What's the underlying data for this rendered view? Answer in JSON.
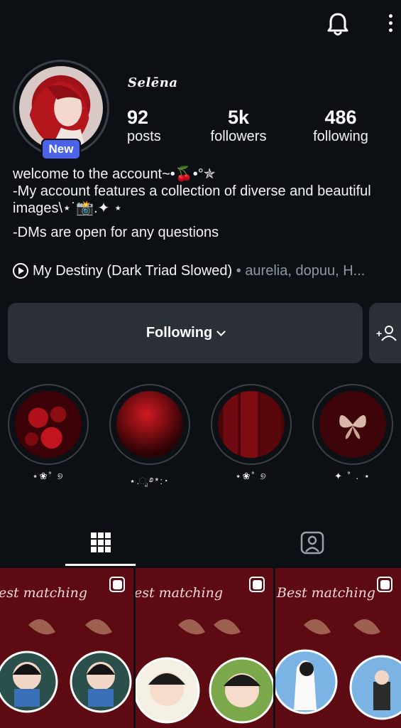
{
  "profile": {
    "username": "Selēna",
    "new_badge": "New",
    "stats": {
      "posts": {
        "value": "92",
        "label": "posts"
      },
      "followers": {
        "value": "5k",
        "label": "followers"
      },
      "following": {
        "value": "486",
        "label": "following"
      }
    },
    "bio": [
      "welcome to the account~•🍒•°✯",
      "-My account features a collection of diverse and beautiful images\\⋆˙📸.✦ ⋆",
      "-DMs are open for any questions"
    ],
    "music": {
      "track": "My Destiny (Dark Triad Slowed)",
      "separator": " • ",
      "artists": "aurelia, dopuu, H..."
    }
  },
  "actions": {
    "following_label": "Following"
  },
  "highlights": [
    {
      "label": "⋆❀˚ ୭"
    },
    {
      "label": "⋆.ೃ࿔*:･"
    },
    {
      "label": "⋆❀˚ ୭"
    },
    {
      "label": "✦ ˚ . ⋆"
    }
  ],
  "tabs": [
    {
      "icon": "grid-icon",
      "active": true
    },
    {
      "icon": "tagged-icon",
      "active": false
    }
  ],
  "posts": [
    {
      "caption": "est matching"
    },
    {
      "caption": "est matching"
    },
    {
      "caption": "Best matching"
    }
  ],
  "colors": {
    "background": "#0c0f14",
    "button": "#2b3038",
    "badge": "#4a63e8",
    "muted": "#8e96a3"
  }
}
